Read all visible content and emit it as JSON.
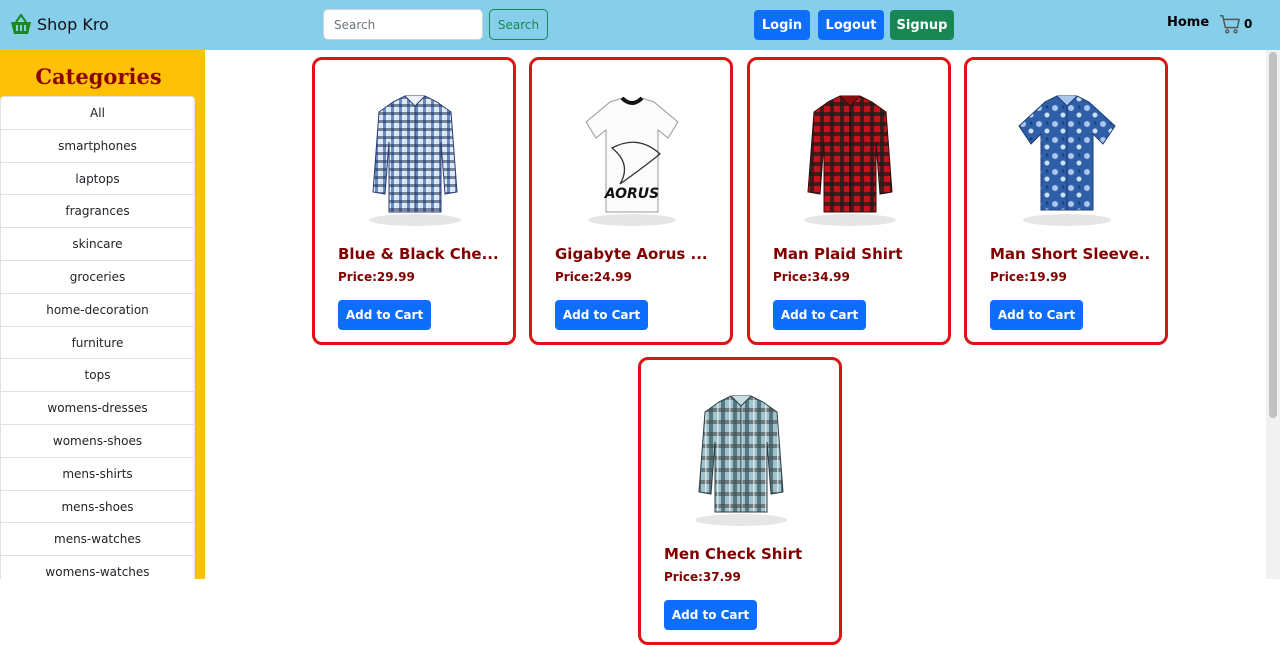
{
  "navbar": {
    "brand": "Shop Kro",
    "brand_icon": "basket-icon",
    "search_placeholder": "Search",
    "search_button": "Search",
    "login": "Login",
    "logout": "Logout",
    "signup": "Signup",
    "home": "Home",
    "cart_icon": "cart-icon",
    "cart_count": "0"
  },
  "sidebar": {
    "title": "Categories",
    "items": [
      "All",
      "smartphones",
      "laptops",
      "fragrances",
      "skincare",
      "groceries",
      "home-decoration",
      "furniture",
      "tops",
      "womens-dresses",
      "womens-shoes",
      "mens-shirts",
      "mens-shoes",
      "mens-watches",
      "womens-watches"
    ]
  },
  "products": [
    {
      "title": "Blue & Black Che...",
      "price": "Price:29.99",
      "button": "Add to Cart",
      "image": "blue-check-shirt"
    },
    {
      "title": "Gigabyte Aorus ...",
      "price": "Price:24.99",
      "button": "Add to Cart",
      "image": "aorus-tshirt"
    },
    {
      "title": "Man Plaid Shirt",
      "price": "Price:34.99",
      "button": "Add to Cart",
      "image": "red-plaid-shirt"
    },
    {
      "title": "Man Short Sleeve...",
      "price": "Price:19.99",
      "button": "Add to Cart",
      "image": "floral-short-sleeve-shirt"
    },
    {
      "title": "Men Check Shirt",
      "price": "Price:37.99",
      "button": "Add to Cart",
      "image": "teal-check-shirt"
    }
  ],
  "colors": {
    "navbar": "#87ceeb",
    "sidebar": "#ffc107",
    "category_title": "#8b0000",
    "card_border": "#dc1414",
    "product_text": "#800000",
    "primary": "#0d6efd",
    "success": "#198754"
  }
}
